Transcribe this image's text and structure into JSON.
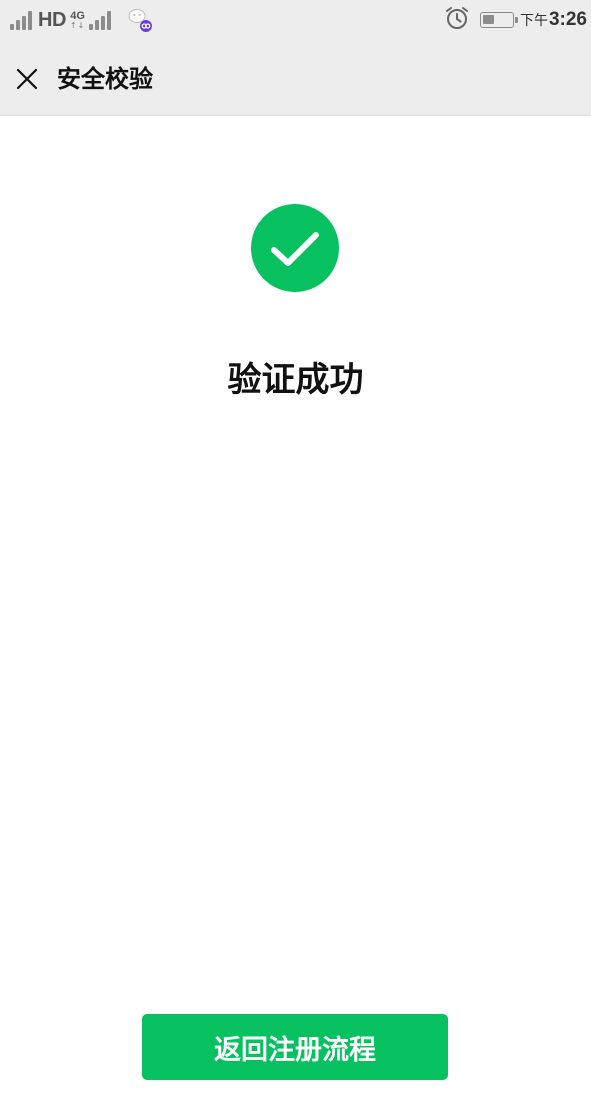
{
  "status_bar": {
    "network_label": "HD",
    "network_gen": "4G",
    "network_arrows": "↑↓",
    "time_ampm": "下午",
    "time": "3:26",
    "battery_level": 0.4
  },
  "nav": {
    "title": "安全校验",
    "close_icon": "close-icon"
  },
  "result": {
    "title": "验证成功",
    "icon": "success-check-icon",
    "icon_color": "#07c160"
  },
  "actions": {
    "return_label": "返回注册流程",
    "button_color": "#07c160"
  }
}
